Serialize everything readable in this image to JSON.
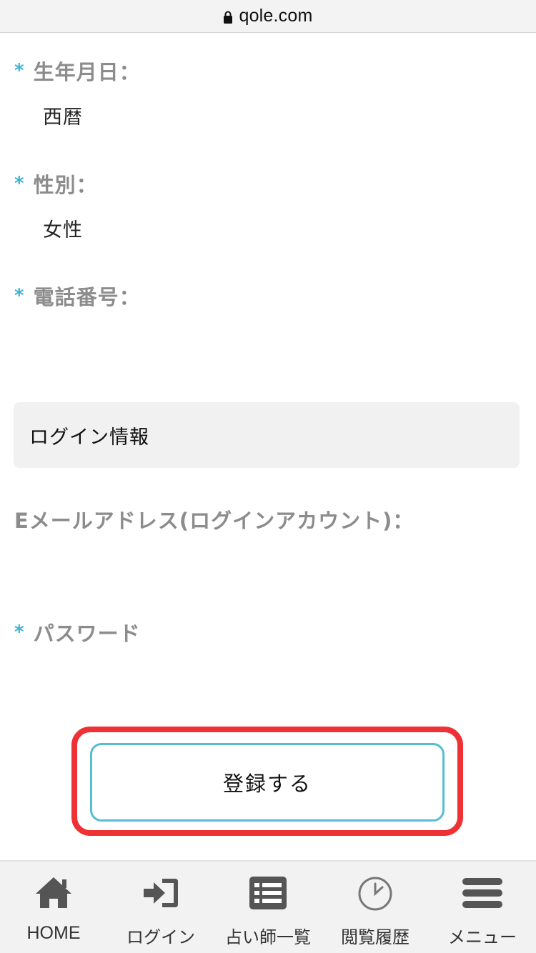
{
  "browser": {
    "url": "qole.com"
  },
  "form": {
    "required_mark": "*",
    "birthdate": {
      "label": "生年月日：",
      "value": "西暦"
    },
    "gender": {
      "label": "性別：",
      "value": "女性"
    },
    "phone": {
      "label": "電話番号：",
      "value": ""
    },
    "login_section_title": "ログイン情報",
    "email": {
      "label": "Eメールアドレス(ログインアカウント)：",
      "value": ""
    },
    "password": {
      "label": "パスワード",
      "value": ""
    },
    "submit_label": "登録する"
  },
  "tabbar": {
    "items": [
      {
        "label": "HOME",
        "icon": "home-icon"
      },
      {
        "label": "ログイン",
        "icon": "login-icon"
      },
      {
        "label": "占い師一覧",
        "icon": "list-icon"
      },
      {
        "label": "閲覧履歴",
        "icon": "clock-icon"
      },
      {
        "label": "メニュー",
        "icon": "menu-icon"
      }
    ]
  },
  "colors": {
    "accent": "#58bcd2",
    "required": "#3cb3d3",
    "highlight": "#ee3134",
    "label": "#8c8c8c",
    "icon": "#555555"
  }
}
